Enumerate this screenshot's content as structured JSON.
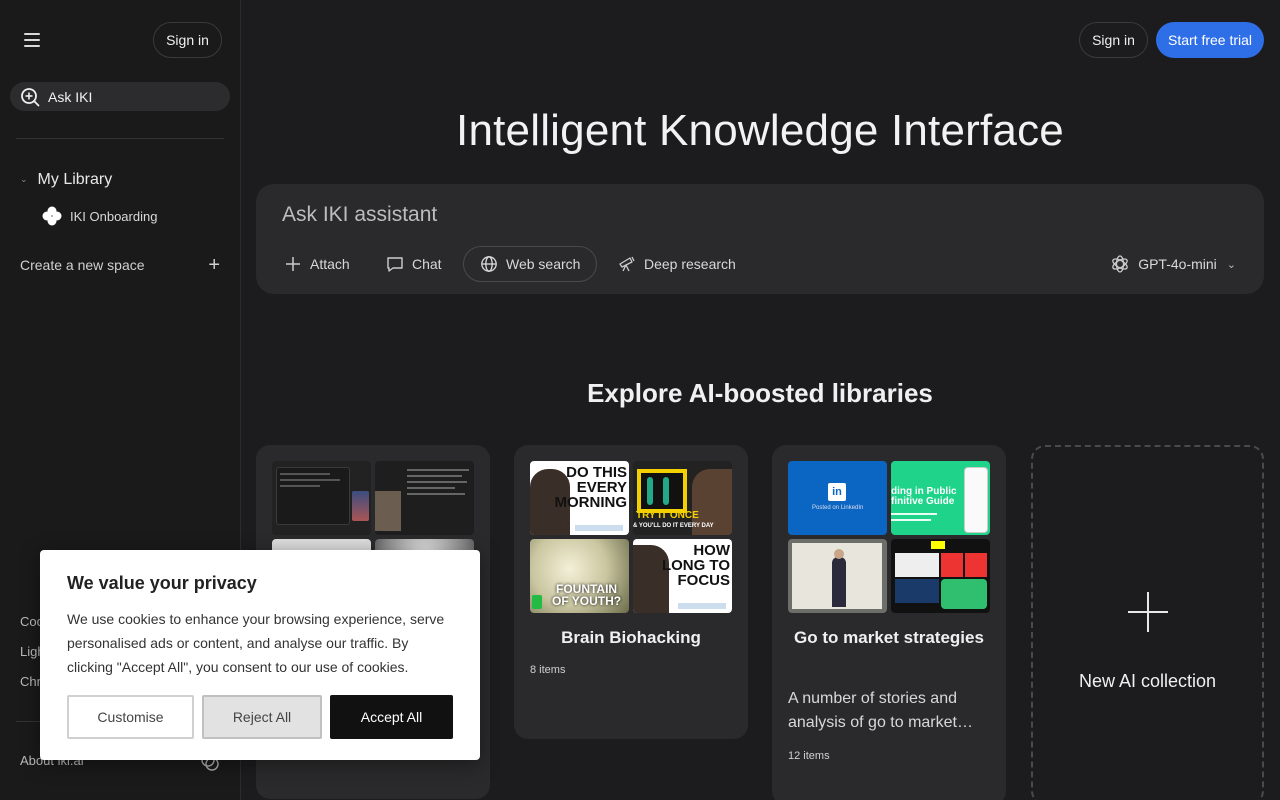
{
  "sidebar": {
    "sign_in": "Sign in",
    "ask_label": "Ask IKI",
    "library_heading": "My Library",
    "library_items": [
      {
        "label": "IKI Onboarding"
      }
    ],
    "create_space": "Create a new space",
    "links": [
      "Coo",
      "Ligh",
      "Chr"
    ],
    "about": "About iki.ai"
  },
  "header": {
    "sign_in": "Sign in",
    "trial": "Start free trial",
    "accent": "#2e6fe8"
  },
  "hero": {
    "title": "Intelligent Knowledge Interface"
  },
  "prompt": {
    "placeholder": "Ask IKI assistant",
    "tools": {
      "attach": "Attach",
      "chat": "Chat",
      "web": "Web search",
      "deep": "Deep research"
    },
    "model": "GPT-4o-mini"
  },
  "explore": {
    "title": "Explore AI-boosted libraries",
    "cards": [
      {
        "title": "",
        "desc": "",
        "count": ""
      },
      {
        "title": "Brain Biohacking",
        "count": "8 items",
        "thumbs": {
          "t1": [
            "DO THIS",
            "EVERY",
            "MORNING"
          ],
          "t2": "TRY IT ONCE",
          "t2b": "& YOU'LL DO IT EVERY DAY",
          "t3": [
            "FOUNTAIN",
            "OF YOUTH?"
          ],
          "t4": [
            "HOW",
            "LONG TO",
            "FOCUS"
          ]
        }
      },
      {
        "title": "Go to market strategies",
        "desc": "A number of stories and analysis of go to market…",
        "count": "12 items",
        "thumbs": {
          "li": "Posted on LinkedIn",
          "bip": [
            "ding in Public",
            "finitive Guide"
          ]
        }
      }
    ],
    "new_collection": "New AI collection"
  },
  "cookie": {
    "title": "We value your privacy",
    "text": "We use cookies to enhance your browsing experience, serve personalised ads or content, and analyse our traffic. By clicking \"Accept All\", you consent to our use of cookies.",
    "customise": "Customise",
    "reject": "Reject All",
    "accept": "Accept All"
  }
}
